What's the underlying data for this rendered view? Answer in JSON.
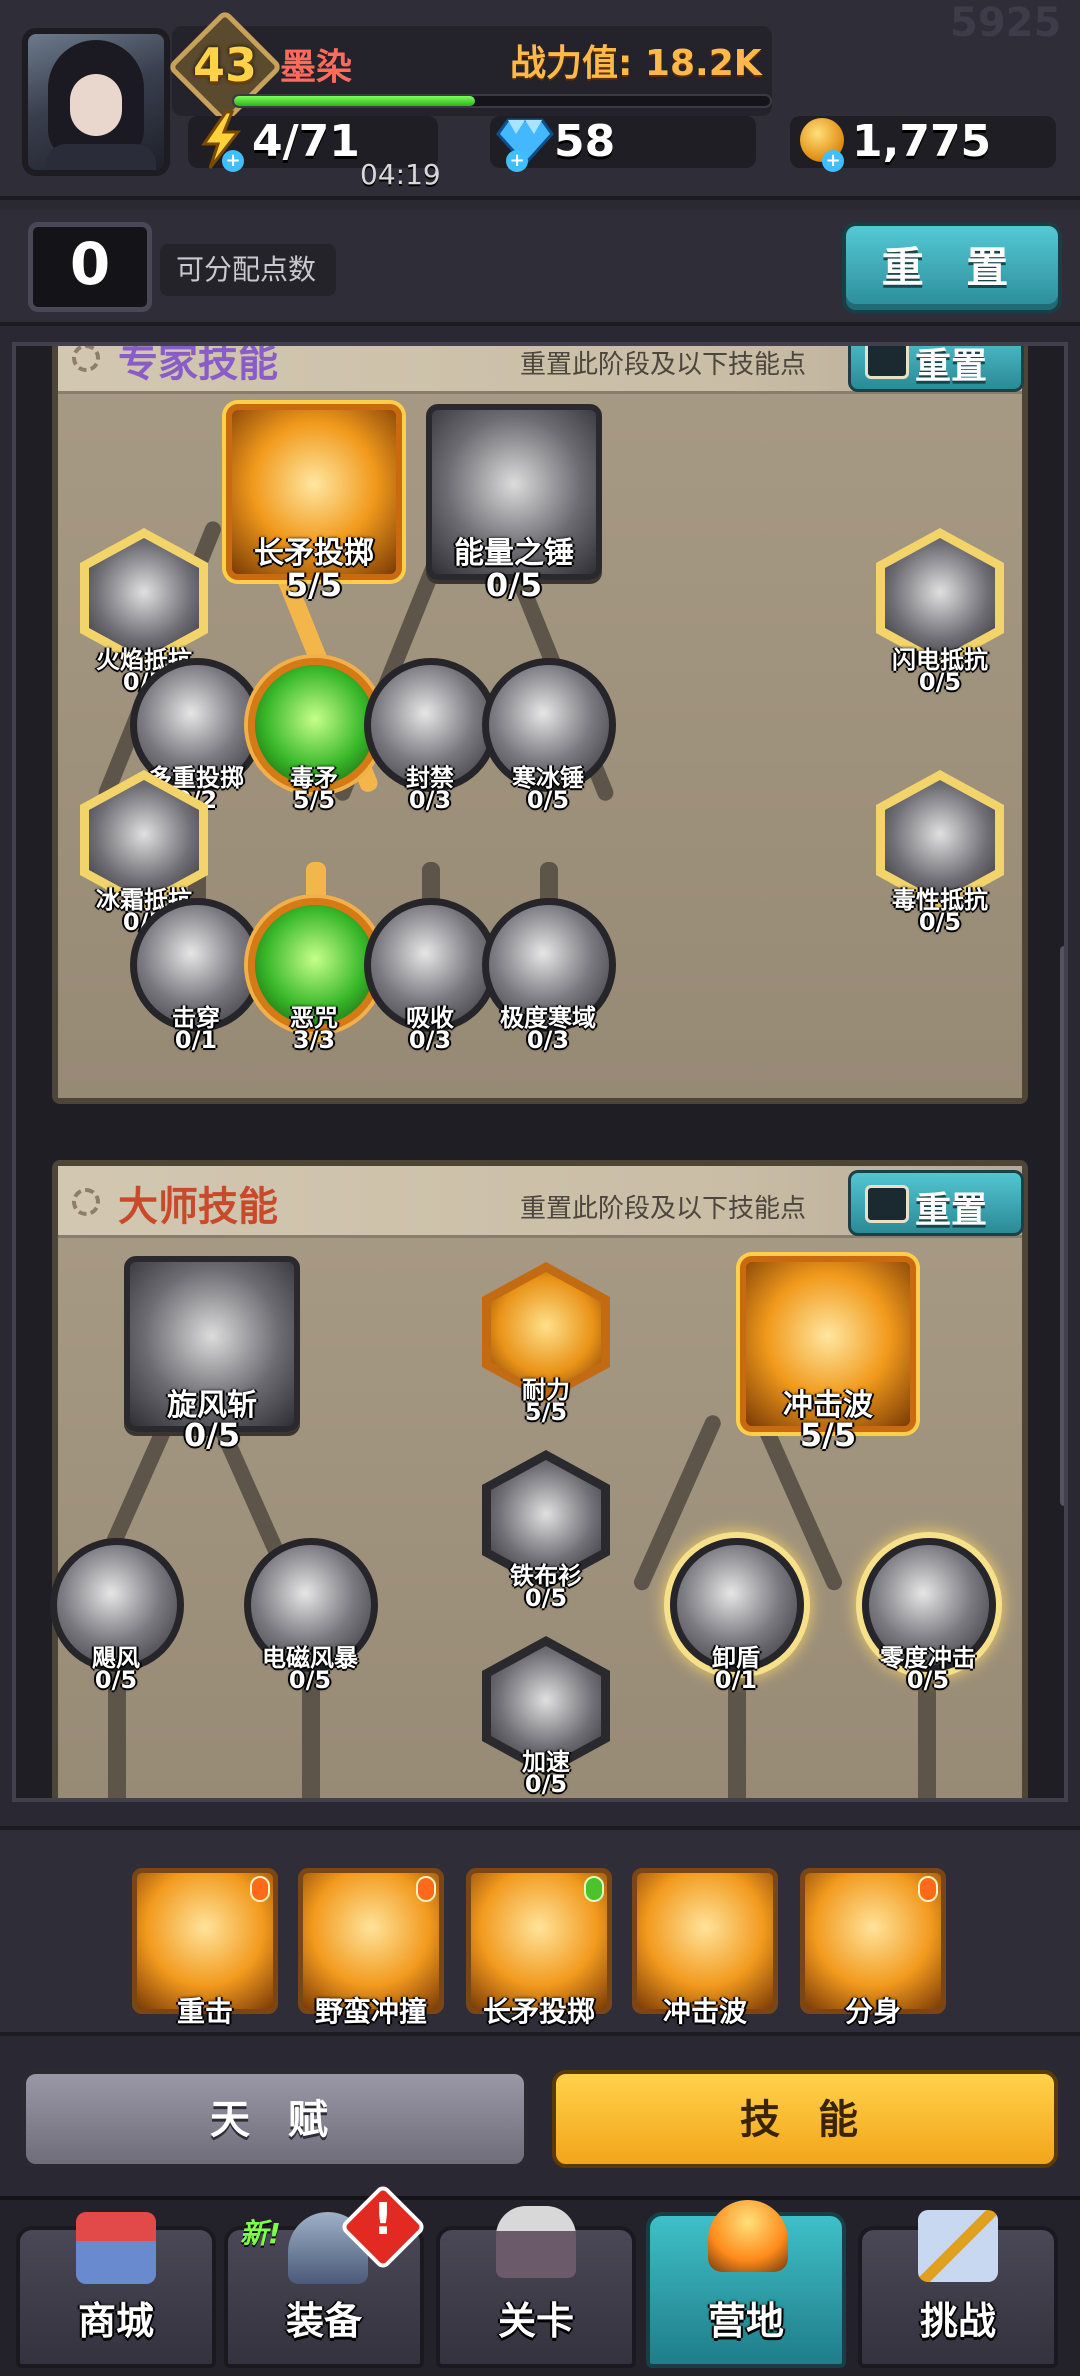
{
  "watermark": "5925",
  "player": {
    "level": "43",
    "name": "墨染",
    "power": "战力值: 18.2K",
    "xp_fraction": 0.45
  },
  "resources": {
    "energy": "4/71",
    "energy_timer": "04:19",
    "gems": "58",
    "gold": "1,775"
  },
  "points": {
    "value": "0",
    "label": "可分配点数",
    "reset_label": "重 置"
  },
  "expert": {
    "title": "专家技能",
    "desc": "重置此阶段及以下技能点",
    "reset": "重置",
    "nodes": [
      {
        "name": "长矛投掷",
        "level": "5/5"
      },
      {
        "name": "能量之锤",
        "level": "0/5"
      },
      {
        "name": "火焰抵抗",
        "level": "0/5"
      },
      {
        "name": "闪电抵抗",
        "level": "0/5"
      },
      {
        "name": "多重投掷",
        "level": "0/2"
      },
      {
        "name": "毒矛",
        "level": "5/5"
      },
      {
        "name": "封禁",
        "level": "0/3"
      },
      {
        "name": "寒冰锤",
        "level": "0/5"
      },
      {
        "name": "冰霜抵抗",
        "level": "0/5"
      },
      {
        "name": "毒性抵抗",
        "level": "0/5"
      },
      {
        "name": "击穿",
        "level": "0/1"
      },
      {
        "name": "恶咒",
        "level": "3/3"
      },
      {
        "name": "吸收",
        "level": "0/3"
      },
      {
        "name": "极度寒域",
        "level": "0/3"
      }
    ]
  },
  "master": {
    "title": "大师技能",
    "desc": "重置此阶段及以下技能点",
    "reset": "重置",
    "nodes": [
      {
        "name": "旋风斩",
        "level": "0/5"
      },
      {
        "name": "耐力",
        "level": "5/5"
      },
      {
        "name": "冲击波",
        "level": "5/5"
      },
      {
        "name": "铁布衫",
        "level": "0/5"
      },
      {
        "name": "飓风",
        "level": "0/5"
      },
      {
        "name": "电磁风暴",
        "level": "0/5"
      },
      {
        "name": "卸盾",
        "level": "0/1"
      },
      {
        "name": "零度冲击",
        "level": "0/5"
      },
      {
        "name": "加速",
        "level": "0/5"
      }
    ]
  },
  "equipped": [
    "重击",
    "野蛮冲撞",
    "长矛投掷",
    "冲击波",
    "分身"
  ],
  "tabs": {
    "talent": "天 赋",
    "skill": "技 能"
  },
  "nav": {
    "shop": "商城",
    "equip": "装备",
    "equip_new": "新!",
    "equip_alert": "!",
    "stage": "关卡",
    "camp": "营地",
    "challenge": "挑战"
  },
  "colors": {
    "expert_title": "#8a5cc8",
    "master_title": "#c84a2a",
    "accent_gold": "#f2a51a",
    "accent_teal": "#3fc0c8"
  }
}
